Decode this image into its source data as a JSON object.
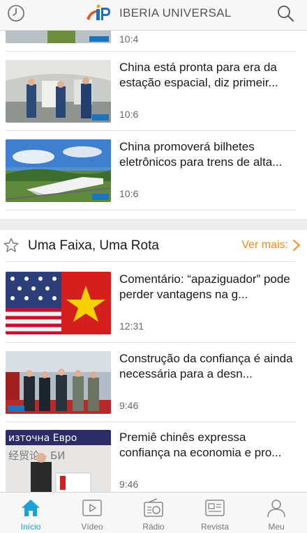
{
  "header": {
    "brand": "IBERIA UNIVERSAL",
    "clock_icon": "clock-icon",
    "search_icon": "search-icon"
  },
  "top_partial": {
    "time": "10:4"
  },
  "news": [
    {
      "title": "China está pronta para era da estação espacial, diz primeir...",
      "time": "10:6",
      "watermark": "新华网"
    },
    {
      "title": "China promoverá bilhetes eletrônicos para trens de alta...",
      "time": "10:6",
      "watermark": "新华网"
    }
  ],
  "section": {
    "title": "Uma Faixa, Uma Rota",
    "more": "Ver  mais:",
    "star_icon": "star-icon",
    "chevron_icon": "chevron-right-icon"
  },
  "section_news": [
    {
      "title": "Comentário: “apaziguador” pode perder vantagens na g...",
      "time": "12:31"
    },
    {
      "title": "Construção da confiança é ainda necessária para a desn...",
      "time": "9:46",
      "watermark": "新华网"
    },
    {
      "title": "Premiê chinês expressa confiança na economia e pro...",
      "time": "9:46",
      "banner_text": "източна Евро",
      "banner_text2": "经贸论 - БИ"
    }
  ],
  "tabbar": [
    {
      "label": "Início",
      "icon": "home-icon",
      "active": true
    },
    {
      "label": "Vídeo",
      "icon": "video-icon",
      "active": false
    },
    {
      "label": "Rádio",
      "icon": "radio-icon",
      "active": false
    },
    {
      "label": "Revista",
      "icon": "magazine-icon",
      "active": false
    },
    {
      "label": "Meu",
      "icon": "user-icon",
      "active": false
    }
  ],
  "colors": {
    "accent": "#f08a1f",
    "tab_active": "#1aa3d8"
  }
}
